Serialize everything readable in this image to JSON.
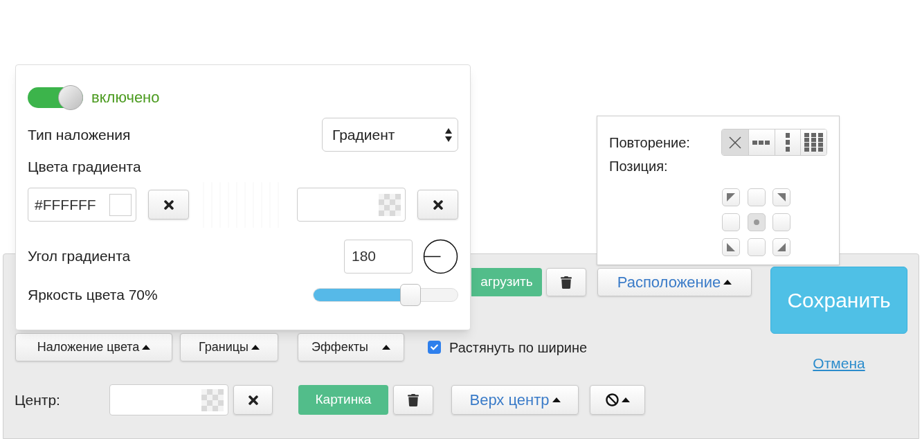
{
  "overlay_popup": {
    "switch": {
      "on": true,
      "label": "включено"
    },
    "overlay_type": {
      "label": "Тип наложения",
      "value": "Градиент"
    },
    "gradient_colors": {
      "label": "Цвета градиента",
      "color_1": "#FFFFFF"
    },
    "angle": {
      "label": "Угол градиента",
      "value": "180"
    },
    "brightness": {
      "label": "Яркость цвета 70%",
      "level": 0.7
    }
  },
  "placement_popup": {
    "repeat_label": "Повторение:",
    "repeat_options": [
      {
        "kind": "none",
        "selected": true
      },
      {
        "kind": "horizontal",
        "selected": false
      },
      {
        "kind": "vertical",
        "selected": false
      },
      {
        "kind": "both",
        "selected": false
      }
    ],
    "position_label": "Позиция:",
    "positions": [
      {
        "kind": "top-left",
        "selected": false
      },
      {
        "kind": "top",
        "selected": false
      },
      {
        "kind": "top-right",
        "selected": false
      },
      {
        "kind": "left",
        "selected": false
      },
      {
        "kind": "center",
        "selected": true
      },
      {
        "kind": "right",
        "selected": false
      },
      {
        "kind": "bottom-left",
        "selected": false
      },
      {
        "kind": "bottom",
        "selected": false
      },
      {
        "kind": "bottom-right",
        "selected": false
      }
    ]
  },
  "toolbar": {
    "upload_button": "агрузить",
    "placement_button": "Расположение",
    "overlay_button": "Наложение цвета",
    "borders_button": "Границы",
    "effects_button": "Эффекты",
    "stretch": {
      "label": "Растянуть по ширине",
      "checked": true
    },
    "center_label": "Центр:",
    "image_button": "Картинка",
    "position_button": "Верх центр"
  },
  "save_button": "Сохранить",
  "cancel_link": "Отмена"
}
